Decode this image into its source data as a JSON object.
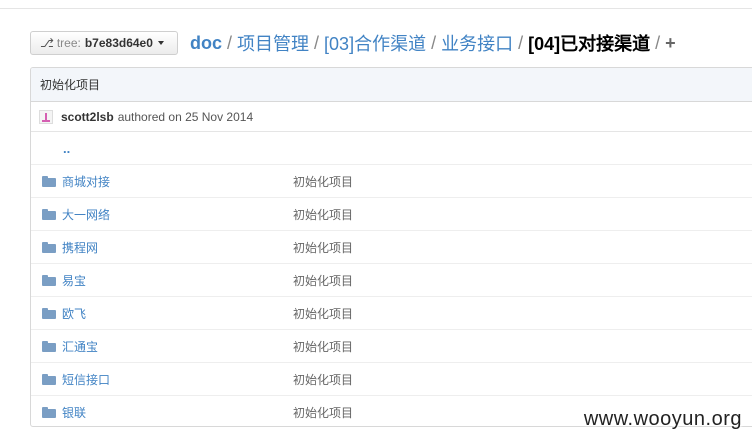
{
  "tree_button": {
    "icon": "branch-icon",
    "label": "tree:",
    "ref": "b7e83d64e0"
  },
  "breadcrumb": {
    "items": [
      "doc",
      "项目管理",
      "[03]合作渠道",
      "业务接口"
    ],
    "current": "[04]已对接渠道",
    "separator": "/",
    "add": "+"
  },
  "table": {
    "header_message": "初始化项目",
    "author": {
      "avatar_icon": "identicon-avatar",
      "name": "scott2lsb",
      "meta": "authored on 25 Nov 2014"
    },
    "parent_link": "..",
    "rows": [
      {
        "name": "商城对接",
        "message": "初始化项目",
        "icon": "folder-icon"
      },
      {
        "name": "大一网络",
        "message": "初始化项目",
        "icon": "folder-icon"
      },
      {
        "name": "携程网",
        "message": "初始化项目",
        "icon": "folder-icon"
      },
      {
        "name": "易宝",
        "message": "初始化项目",
        "icon": "folder-icon"
      },
      {
        "name": "欧飞",
        "message": "初始化项目",
        "icon": "folder-icon"
      },
      {
        "name": "汇通宝",
        "message": "初始化项目",
        "icon": "folder-icon"
      },
      {
        "name": "短信接口",
        "message": "初始化项目",
        "icon": "folder-icon"
      },
      {
        "name": "银联",
        "message": "初始化项目",
        "icon": "folder-icon"
      }
    ]
  },
  "watermark": "www.wooyun.org",
  "colors": {
    "link": "#4183c4",
    "folder": "#7a9ec4",
    "header_bg": "#f3f6fa",
    "border": "#d8d8d8"
  }
}
